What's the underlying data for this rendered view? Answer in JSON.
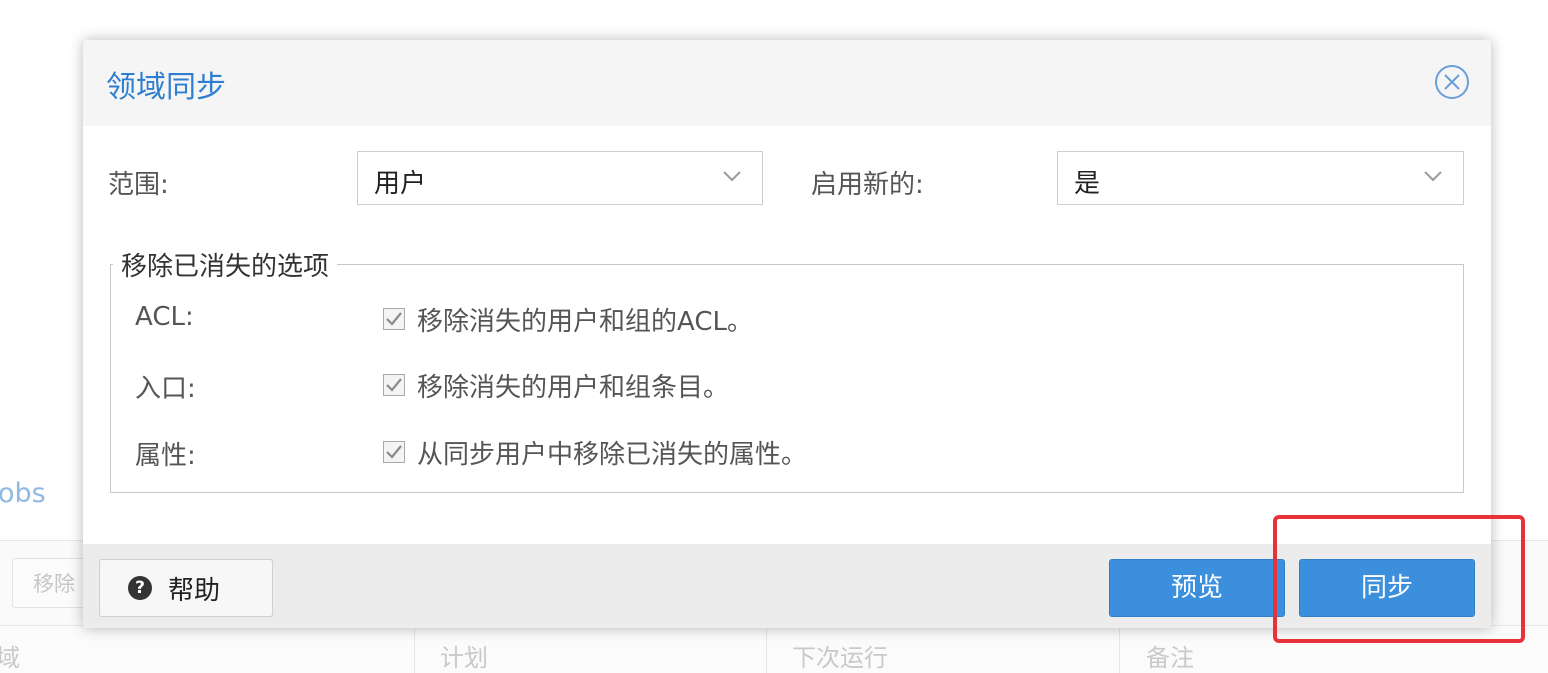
{
  "background": {
    "panel_title": "obs",
    "toolbar_button": "移除",
    "grid_columns": [
      "域",
      "计划",
      "下次运行",
      "备注"
    ]
  },
  "dialog": {
    "title": "领域同步",
    "scope": {
      "label": "范围:",
      "value": "用户"
    },
    "enable_new": {
      "label": "启用新的:",
      "value": "是"
    },
    "remove_vanished": {
      "legend": "移除已消失的选项",
      "rows": [
        {
          "label": "ACL:",
          "checkbox_text": "移除消失的用户和组的ACL。",
          "checked": true
        },
        {
          "label": "入口:",
          "checkbox_text": "移除消失的用户和组条目。",
          "checked": true
        },
        {
          "label": "属性:",
          "checkbox_text": "从同步用户中移除已消失的属性。",
          "checked": true
        }
      ]
    },
    "footer": {
      "help_label": "帮助",
      "preview_label": "预览",
      "sync_label": "同步"
    }
  },
  "colors": {
    "accent": "#3b8fdc",
    "title": "#2e7fd0",
    "highlight": "#e8323a"
  },
  "icons": [
    "close-circle-icon",
    "chevron-down-icon",
    "checkmark-icon",
    "question-circle-icon"
  ]
}
